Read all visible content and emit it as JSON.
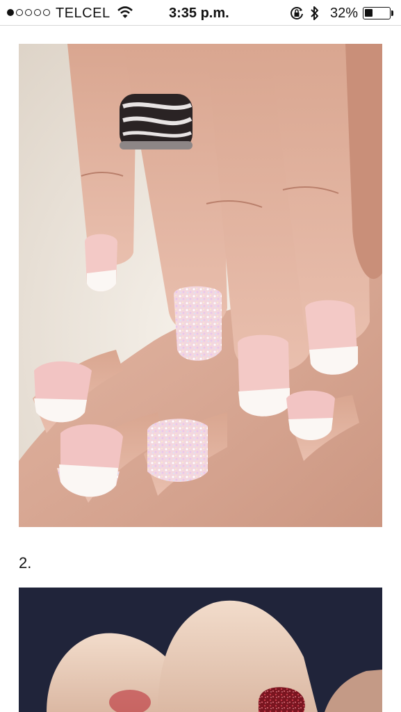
{
  "status_bar": {
    "carrier": "TELCEL",
    "time": "3:35 p.m.",
    "battery_percent": "32%",
    "battery_level": 0.32,
    "signal_bars_filled": 1,
    "signal_bars_total": 5,
    "icons": [
      "wifi-icon",
      "orientation-lock-icon",
      "bluetooth-icon",
      "battery-icon"
    ]
  },
  "content": {
    "images": [
      {
        "name": "french-manicure-with-glitter-accent-photo"
      },
      {
        "name": "dark-red-glitter-nail-photo"
      }
    ],
    "list_number": "2."
  }
}
